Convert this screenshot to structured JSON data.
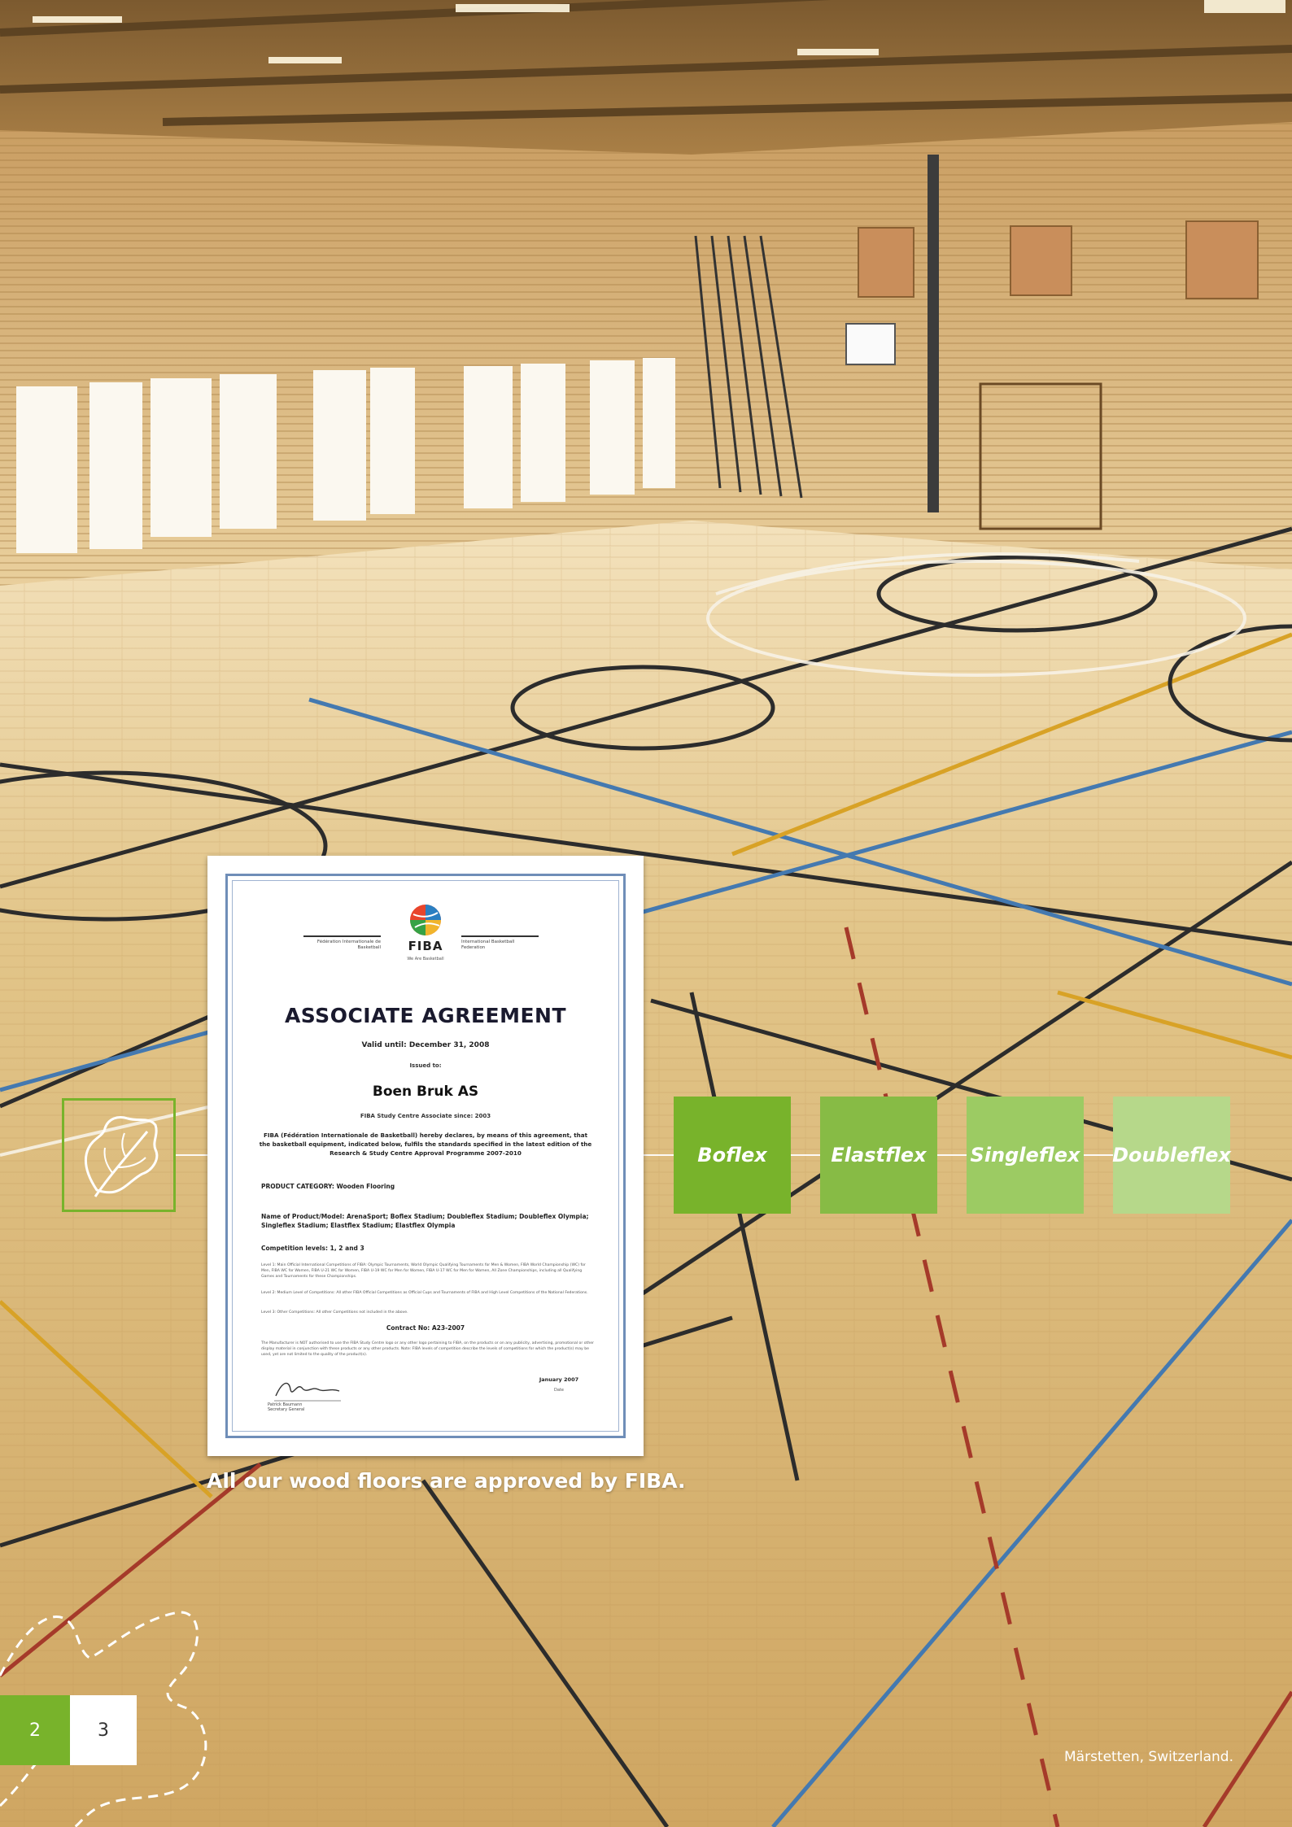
{
  "certificate": {
    "org_left": "Fédération Internationale de Basketball",
    "org_right": "International Basketball Federation",
    "logo_word": "FIBA",
    "logo_tagline": "We Are Basketball",
    "title": "ASSOCIATE AGREEMENT",
    "valid_until": "Valid until: December 31, 2008",
    "issued_to": "Issued to:",
    "company": "Boen Bruk AS",
    "since": "FIBA Study Centre Associate since: 2003",
    "declaration": "FIBA (Fédération Internationale de Basketball) hereby declares, by means of this agreement, that the basketball equipment, indicated below, fulfils the standards specified in the latest edition of the Research & Study Centre Approval Programme 2007-2010",
    "category": "PRODUCT CATEGORY: Wooden Flooring",
    "model": "Name of Product/Model: ArenaSport; Boflex Stadium; Doubleflex Stadium; Doubleflex Olympia; Singleflex Stadium; Elastflex Stadium; Elastflex Olympia",
    "levels": "Competition levels: 1, 2 and 3",
    "level1": "Level 1: Main Official International Competitions of FIBA: Olympic Tournaments, World Olympic Qualifying Tournaments for Men & Women, FIBA World Championship (WC) for Men, FIBA WC for Women, FIBA U-21 WC for Women, FIBA U-19 WC for Men for Women, FIBA U-17 WC for Men for Women, All Zone Championships, including all Qualifying Games and Tournaments for these Championships.",
    "level2": "Level 2: Medium Level of Competitions: All other FIBA Official Competitions as Official Cups and Tournaments of FIBA and High Level Competitions of the National Federations.",
    "level3": "Level 3: Other Competitions: All other Competitions not included in the above.",
    "contract": "Contract No: A23-2007",
    "terms": "The Manufacturer is NOT authorised to use the FIBA Study Centre logo or any other logo pertaining to FIBA, on the products or on any publicity, advertising, promotional or other display material in conjunction with these products or any other products. Note: FIBA levels of competition describe the levels of competitions for which the product(s) may be used, yet are not limited to the quality of the product(s).",
    "signer_name": "Patrick Baumann",
    "signer_title": "Secretary General",
    "date": "January 2007",
    "date_label": "Date"
  },
  "caption": "All our wood floors are approved by FIBA.",
  "products": [
    {
      "label": "Boflex",
      "color": "#78b32b"
    },
    {
      "label": "Elastflex",
      "color": "#87bb45"
    },
    {
      "label": "Singleflex",
      "color": "#9ccb63"
    },
    {
      "label": "Doubleflex",
      "color": "#b6d88a"
    }
  ],
  "leaf_icon": "oak-leaf-icon",
  "accent_color": "#78b32b",
  "pages": {
    "left": "2",
    "right": "3"
  },
  "location": "Märstetten, Switzerland."
}
